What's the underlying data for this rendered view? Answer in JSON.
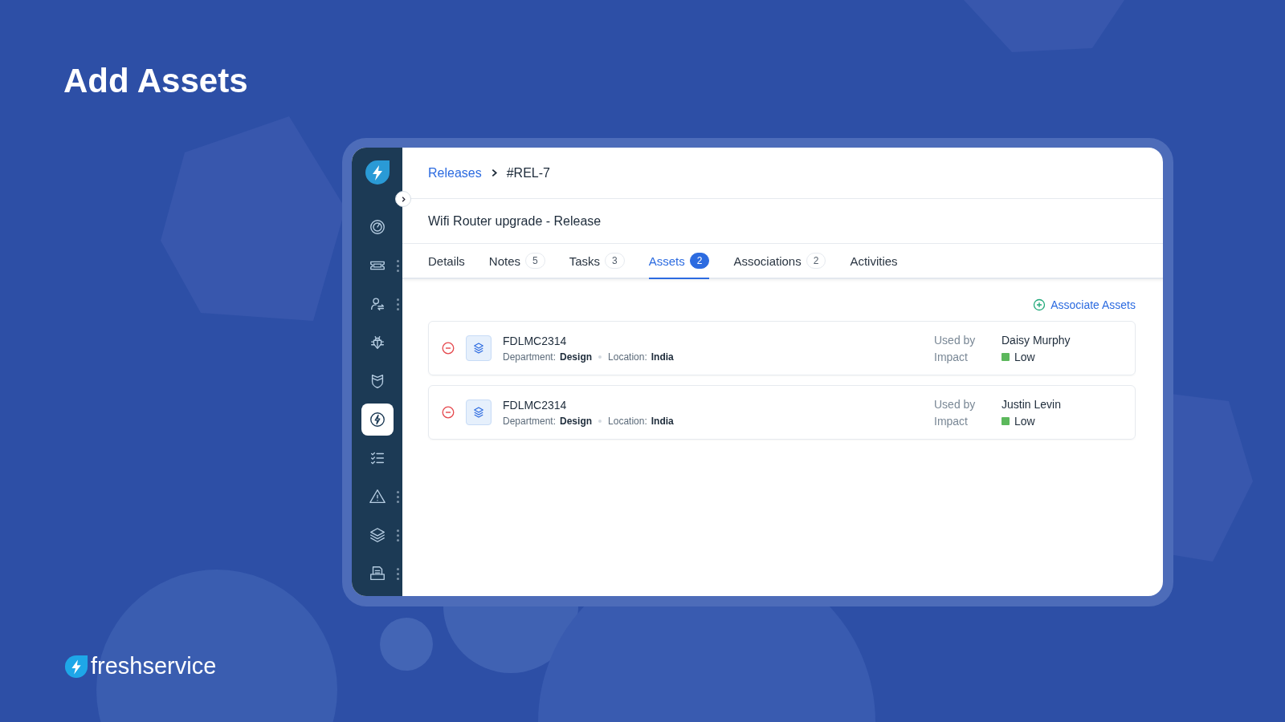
{
  "heading": "Add Assets",
  "sidebar": {
    "items": [
      {
        "selected": false,
        "more": false
      },
      {
        "selected": false,
        "more": true
      },
      {
        "selected": false,
        "more": true
      },
      {
        "selected": false,
        "more": false
      },
      {
        "selected": false,
        "more": false
      },
      {
        "selected": true,
        "more": false
      },
      {
        "selected": false,
        "more": false
      },
      {
        "selected": false,
        "more": true
      },
      {
        "selected": false,
        "more": true
      },
      {
        "selected": false,
        "more": true
      }
    ]
  },
  "breadcrumb": {
    "parent": "Releases",
    "current": "#REL-7"
  },
  "record_title": "Wifi Router upgrade - Release",
  "tabs": [
    {
      "label": "Details",
      "selected": false
    },
    {
      "label": "Notes",
      "count": "5",
      "selected": false
    },
    {
      "label": "Tasks",
      "count": "3",
      "selected": false
    },
    {
      "label": "Assets",
      "count": "2",
      "selected": true
    },
    {
      "label": "Associations",
      "count": "2",
      "selected": false
    },
    {
      "label": "Activities",
      "selected": false
    }
  ],
  "associate_button": "Associate Assets",
  "assets": [
    {
      "name": "FDLMC2314",
      "department_label": "Department:",
      "department": "Design",
      "location_label": "Location:",
      "location": "India",
      "used_by_label": "Used by",
      "used_by": "Daisy Murphy",
      "impact_label": "Impact",
      "impact": "Low"
    },
    {
      "name": "FDLMC2314",
      "department_label": "Department:",
      "department": "Design",
      "location_label": "Location:",
      "location": "India",
      "used_by_label": "Used by",
      "used_by": "Justin Levin",
      "impact_label": "Impact",
      "impact": "Low"
    }
  ],
  "brand": "freshservice"
}
